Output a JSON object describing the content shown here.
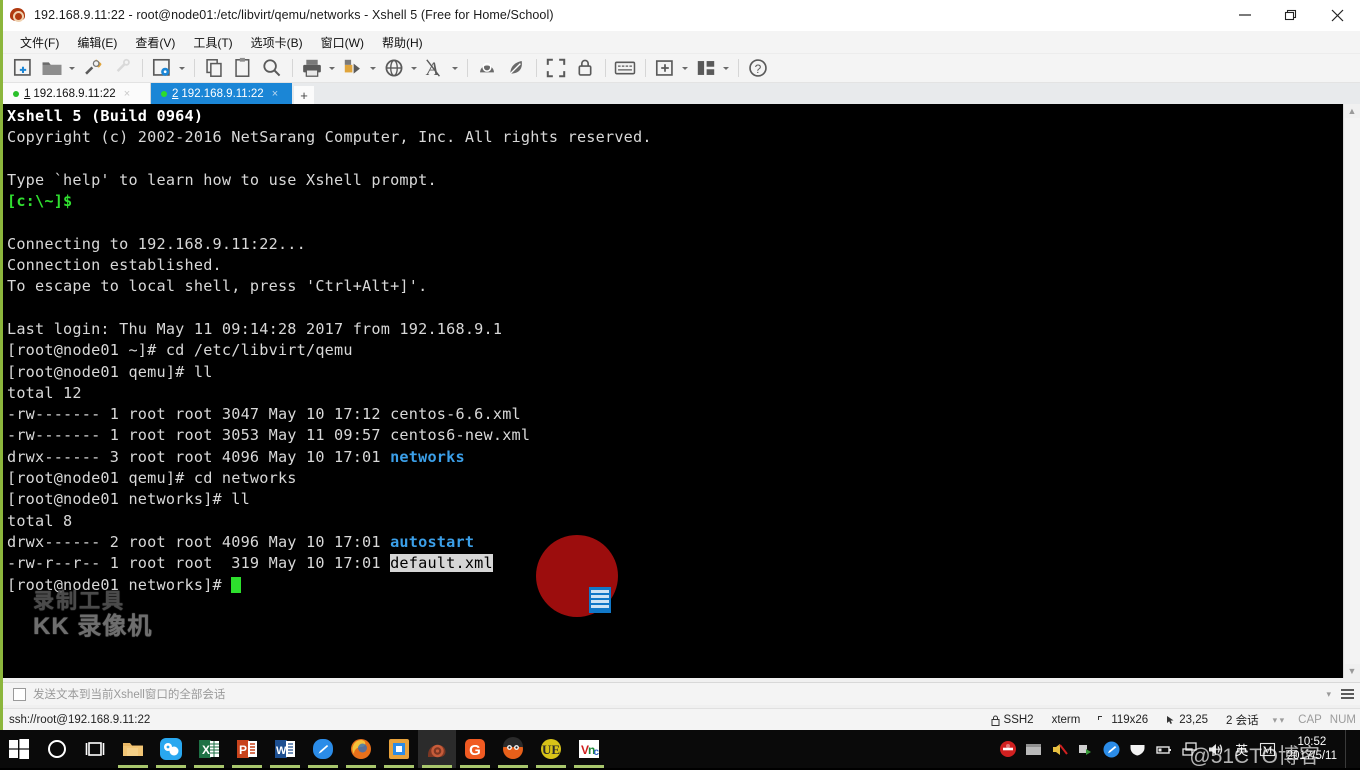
{
  "window": {
    "title": "192.168.9.11:22 - root@node01:/etc/libvirt/qemu/networks - Xshell 5 (Free for Home/School)",
    "icon": "xshell-snail-icon",
    "minimize_label": "—",
    "restore_label": "❐",
    "close_label": "✕"
  },
  "menubar": {
    "items": [
      {
        "name": "file",
        "label": "文件(F)"
      },
      {
        "name": "edit",
        "label": "编辑(E)"
      },
      {
        "name": "view",
        "label": "查看(V)"
      },
      {
        "name": "tools",
        "label": "工具(T)"
      },
      {
        "name": "tabs",
        "label": "选项卡(B)"
      },
      {
        "name": "window",
        "label": "窗口(W)"
      },
      {
        "name": "help",
        "label": "帮助(H)"
      }
    ]
  },
  "toolbar": {
    "buttons": [
      {
        "name": "new-session-icon",
        "glyph": "new"
      },
      {
        "name": "open-folder-icon",
        "glyph": "folder",
        "caret": true
      },
      {
        "name": "reconnect-icon",
        "glyph": "plug"
      },
      {
        "name": "disconnect-icon",
        "glyph": "plug-off",
        "disabled": true
      },
      {
        "name": "properties-icon",
        "glyph": "gear-page",
        "caret": true
      },
      {
        "name": "copy-icon",
        "glyph": "copy"
      },
      {
        "name": "paste-icon",
        "glyph": "paste"
      },
      {
        "name": "find-icon",
        "glyph": "search"
      },
      {
        "name": "print-icon",
        "glyph": "print",
        "caret": true
      },
      {
        "name": "transfer-icon",
        "glyph": "transfer",
        "caret": true
      },
      {
        "name": "encoding-icon",
        "glyph": "globe",
        "caret": true
      },
      {
        "name": "font-icon",
        "glyph": "font-a",
        "caret": true
      },
      {
        "name": "compose-icon",
        "glyph": "shell1"
      },
      {
        "name": "highlight-icon",
        "glyph": "shell2"
      },
      {
        "name": "fullscreen-icon",
        "glyph": "fullscreen"
      },
      {
        "name": "lock-icon",
        "glyph": "lock"
      },
      {
        "name": "keyboard-icon",
        "glyph": "keyboard"
      },
      {
        "name": "add-panel-icon",
        "glyph": "add-box",
        "caret": true
      },
      {
        "name": "layout-icon",
        "glyph": "layout",
        "caret": true
      },
      {
        "name": "help-icon",
        "glyph": "question"
      }
    ]
  },
  "tabs": {
    "items": [
      {
        "name": "tab-session-1",
        "number": "1",
        "label": "192.168.9.11:22",
        "active": false
      },
      {
        "name": "tab-session-2",
        "number": "2",
        "label": "192.168.9.11:22",
        "active": true
      }
    ],
    "close_glyph": "×",
    "add_label": "+"
  },
  "terminal": {
    "lines": [
      [
        {
          "t": "Xshell 5 (Build 0964)",
          "c": "b-white"
        }
      ],
      [
        {
          "t": "Copyright (c) 2002-2016 NetSarang Computer, Inc. All rights reserved.",
          "c": ""
        }
      ],
      [
        {
          "t": "",
          "c": ""
        }
      ],
      [
        {
          "t": "Type `help' to learn how to use Xshell prompt.",
          "c": ""
        }
      ],
      [
        {
          "t": "[c:\\~]$",
          "c": "g-green"
        }
      ],
      [
        {
          "t": "",
          "c": ""
        }
      ],
      [
        {
          "t": "Connecting to 192.168.9.11:22...",
          "c": ""
        }
      ],
      [
        {
          "t": "Connection established.",
          "c": ""
        }
      ],
      [
        {
          "t": "To escape to local shell, press 'Ctrl+Alt+]'.",
          "c": ""
        }
      ],
      [
        {
          "t": "",
          "c": ""
        }
      ],
      [
        {
          "t": "Last login: Thu May 11 09:14:28 2017 from 192.168.9.1",
          "c": ""
        }
      ],
      [
        {
          "t": "[root@node01 ~]# cd /etc/libvirt/qemu",
          "c": ""
        }
      ],
      [
        {
          "t": "[root@node01 qemu]# ll",
          "c": ""
        }
      ],
      [
        {
          "t": "total 12",
          "c": ""
        }
      ],
      [
        {
          "t": "-rw------- 1 root root 3047 May 10 17:12 centos-6.6.xml",
          "c": ""
        }
      ],
      [
        {
          "t": "-rw------- 1 root root 3053 May 11 09:57 centos6-new.xml",
          "c": ""
        }
      ],
      [
        {
          "t": "drwx------ 3 root root 4096 May 10 17:01 ",
          "c": ""
        },
        {
          "t": "networks",
          "c": "c-blue"
        }
      ],
      [
        {
          "t": "[root@node01 qemu]# cd networks",
          "c": ""
        }
      ],
      [
        {
          "t": "[root@node01 networks]# ll",
          "c": ""
        }
      ],
      [
        {
          "t": "total 8",
          "c": ""
        }
      ],
      [
        {
          "t": "drwx------ 2 root root 4096 May 10 17:01 ",
          "c": ""
        },
        {
          "t": "autostart",
          "c": "c-blue"
        }
      ],
      [
        {
          "t": "-rw-r--r-- 1 root root  319 May 10 17:01 ",
          "c": ""
        },
        {
          "t": "default.xml",
          "c": "sel"
        }
      ],
      [
        {
          "t": "[root@node01 networks]# ",
          "c": ""
        },
        {
          "t": "",
          "c": "cursor"
        }
      ]
    ],
    "watermark_line1": "录制工具",
    "watermark_line2": "KK 录像机"
  },
  "sendbar": {
    "label": "发送文本到当前Xshell窗口的全部会话",
    "caret": "▾",
    "menu_icon": "hamburger-icon"
  },
  "statusbar": {
    "url": "ssh://root@192.168.9.11:22",
    "protocol": "SSH2",
    "term_type": "xterm",
    "size": "119x26",
    "cursor_pos": "23,25",
    "sessions": "2 会话",
    "cap": "CAP",
    "num": "NUM",
    "lock_icon": "lock-icon",
    "size_icon": "screen-size-icon",
    "cursor_icon": "cursor-pos-icon"
  },
  "taskbar": {
    "items": [
      {
        "name": "start-button",
        "glyph": "windows",
        "running": false
      },
      {
        "name": "cortana-search",
        "glyph": "circle",
        "running": false
      },
      {
        "name": "task-view",
        "glyph": "taskview",
        "running": false
      },
      {
        "name": "file-explorer",
        "glyph": "folder",
        "running": true
      },
      {
        "name": "qq-app",
        "glyph": "qq",
        "running": true
      },
      {
        "name": "excel-app",
        "glyph": "excel",
        "running": true
      },
      {
        "name": "powerpoint-app",
        "glyph": "ppt",
        "running": true
      },
      {
        "name": "word-app",
        "glyph": "word",
        "running": true
      },
      {
        "name": "editor-app",
        "glyph": "bluedrop",
        "running": true
      },
      {
        "name": "firefox-app",
        "glyph": "firefox",
        "running": true
      },
      {
        "name": "ie-app",
        "glyph": "ie",
        "running": true
      },
      {
        "name": "xshell-app",
        "glyph": "snail",
        "running": true,
        "active": true
      },
      {
        "name": "g-app",
        "glyph": "gorange",
        "running": true
      },
      {
        "name": "face-app",
        "glyph": "face",
        "running": true
      },
      {
        "name": "ultraedit-app",
        "glyph": "ue",
        "running": true
      },
      {
        "name": "vnc-app",
        "glyph": "vnc",
        "running": true
      }
    ],
    "tray": [
      {
        "name": "tray-security-icon",
        "glyph": "red-circle"
      },
      {
        "name": "tray-display-icon",
        "glyph": "display"
      },
      {
        "name": "tray-sound-off-icon",
        "glyph": "sound-off"
      },
      {
        "name": "tray-network-share-icon",
        "glyph": "netshare"
      },
      {
        "name": "tray-drop-icon",
        "glyph": "drop"
      },
      {
        "name": "tray-shield-icon",
        "glyph": "shield"
      },
      {
        "name": "tray-battery-icon",
        "glyph": "battery"
      },
      {
        "name": "tray-network-icon",
        "glyph": "monitor"
      },
      {
        "name": "tray-volume-icon",
        "glyph": "volume"
      },
      {
        "name": "tray-ime-icon",
        "glyph": "text",
        "text": "英"
      },
      {
        "name": "tray-ime-mode-icon",
        "glyph": "text-box",
        "text": "M"
      }
    ],
    "clock": {
      "time": "10:52",
      "date": "2017/5/11"
    }
  },
  "overlay": {
    "click_indicator": "red-click-highlight",
    "cto_watermark": "@51CTO博客"
  }
}
